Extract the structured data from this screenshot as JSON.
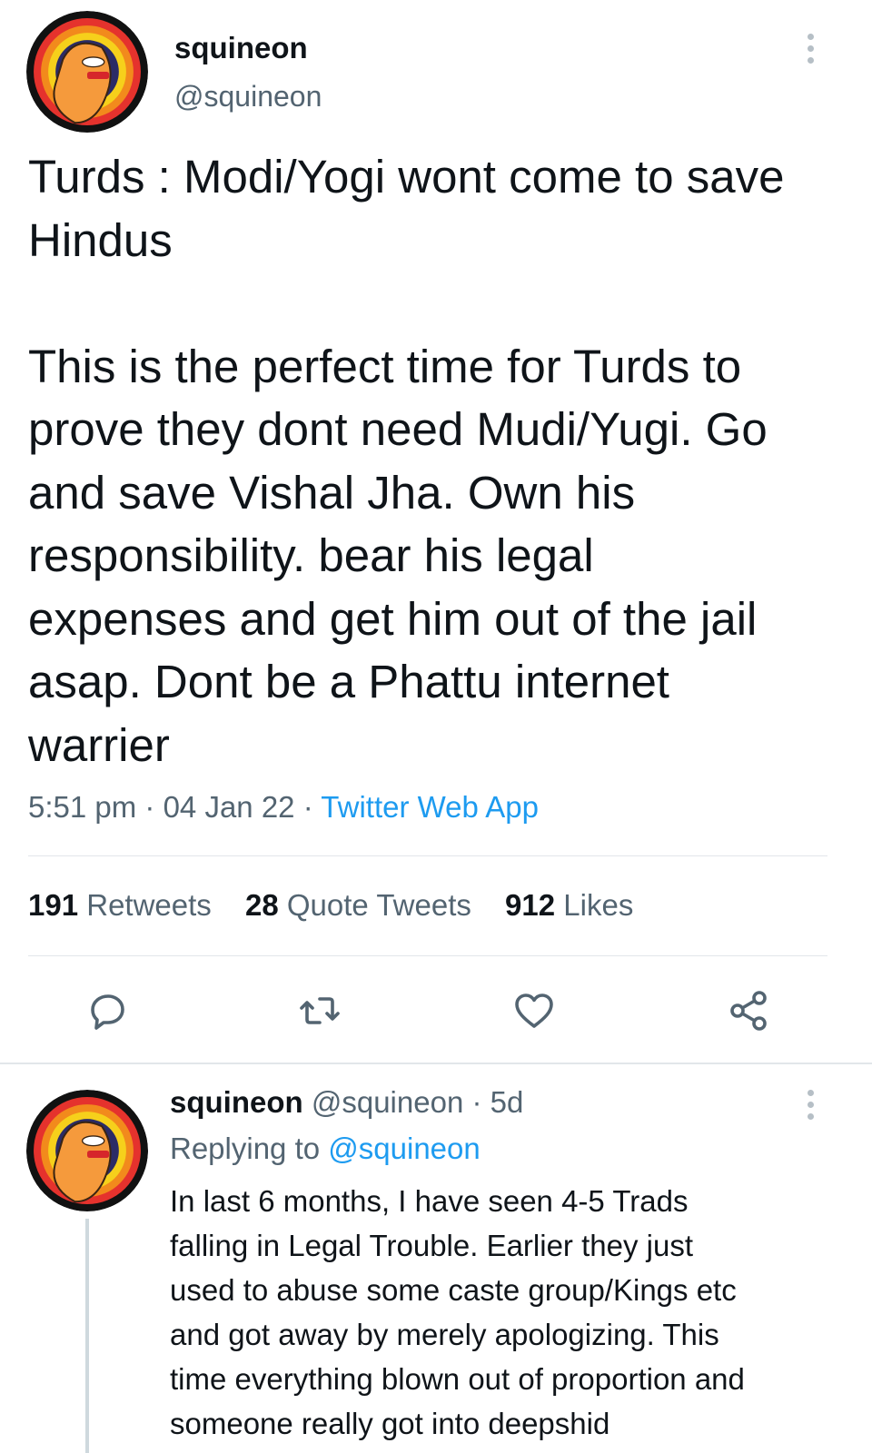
{
  "tweet": {
    "author_name": "squineon",
    "author_handle": "@squineon",
    "body": "Turds : Modi/Yogi wont come to save\nHindus\n\nThis is the perfect time for Turds to\nprove they dont need Mudi/Yugi. Go\nand save Vishal Jha. Own his\nresponsibility. bear his legal\nexpenses and get him out of the jail\nasap. Dont be a Phattu internet\nwarrier",
    "time": "5:51 pm",
    "separator": " · ",
    "date": "04 Jan 22",
    "source": "Twitter Web App",
    "stats": [
      {
        "count": "191",
        "label": "Retweets"
      },
      {
        "count": "28",
        "label": "Quote Tweets"
      },
      {
        "count": "912",
        "label": "Likes"
      }
    ]
  },
  "reply": {
    "author_name": "squineon",
    "author_handle": "@squineon",
    "age": "5d",
    "age_separator": " · ",
    "replying_to_label": "Replying to",
    "replying_to_handle": "@squineon",
    "body": "In last 6 months, I have seen 4-5 Trads\nfalling in Legal Trouble. Earlier they just\nused to abuse some caste group/Kings etc\nand got away by merely apologizing. This\ntime everything blown out of proportion and\nsomeone really got into deepshid"
  },
  "icons": {
    "more": "more-vertical-icon",
    "reply": "reply-icon",
    "retweet": "retweet-icon",
    "like": "heart-icon",
    "share": "share-icon"
  },
  "colors": {
    "link": "#1d9bf0",
    "muted": "#536471",
    "text": "#0f1419"
  }
}
